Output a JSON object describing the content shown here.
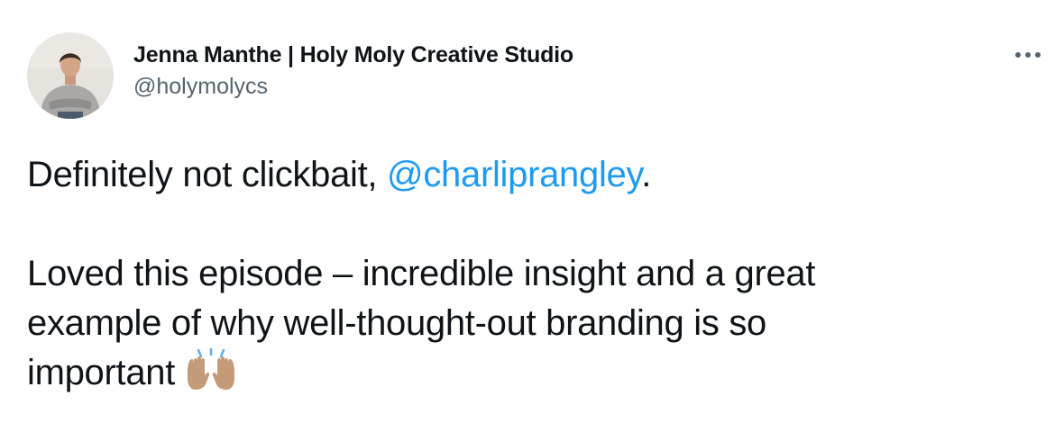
{
  "author": {
    "display_name": "Jenna Manthe | Holy Moly Creative Studio",
    "handle": "@holymolycs",
    "avatar_icon": "profile-photo"
  },
  "menu": {
    "more_icon": "more-horizontal-icon"
  },
  "tweet": {
    "line1_prefix": "Definitely not clickbait, ",
    "mention": "@charliprangley",
    "line1_suffix": ".",
    "para2_line1": "Loved this episode – incredible insight and a great",
    "para2_line2": "example of why well-thought-out branding is so",
    "para2_line3": "important",
    "emoji_icon": "raising-hands-emoji"
  },
  "colors": {
    "link": "#1d9bf0",
    "text": "#0f1419",
    "muted": "#536471"
  }
}
